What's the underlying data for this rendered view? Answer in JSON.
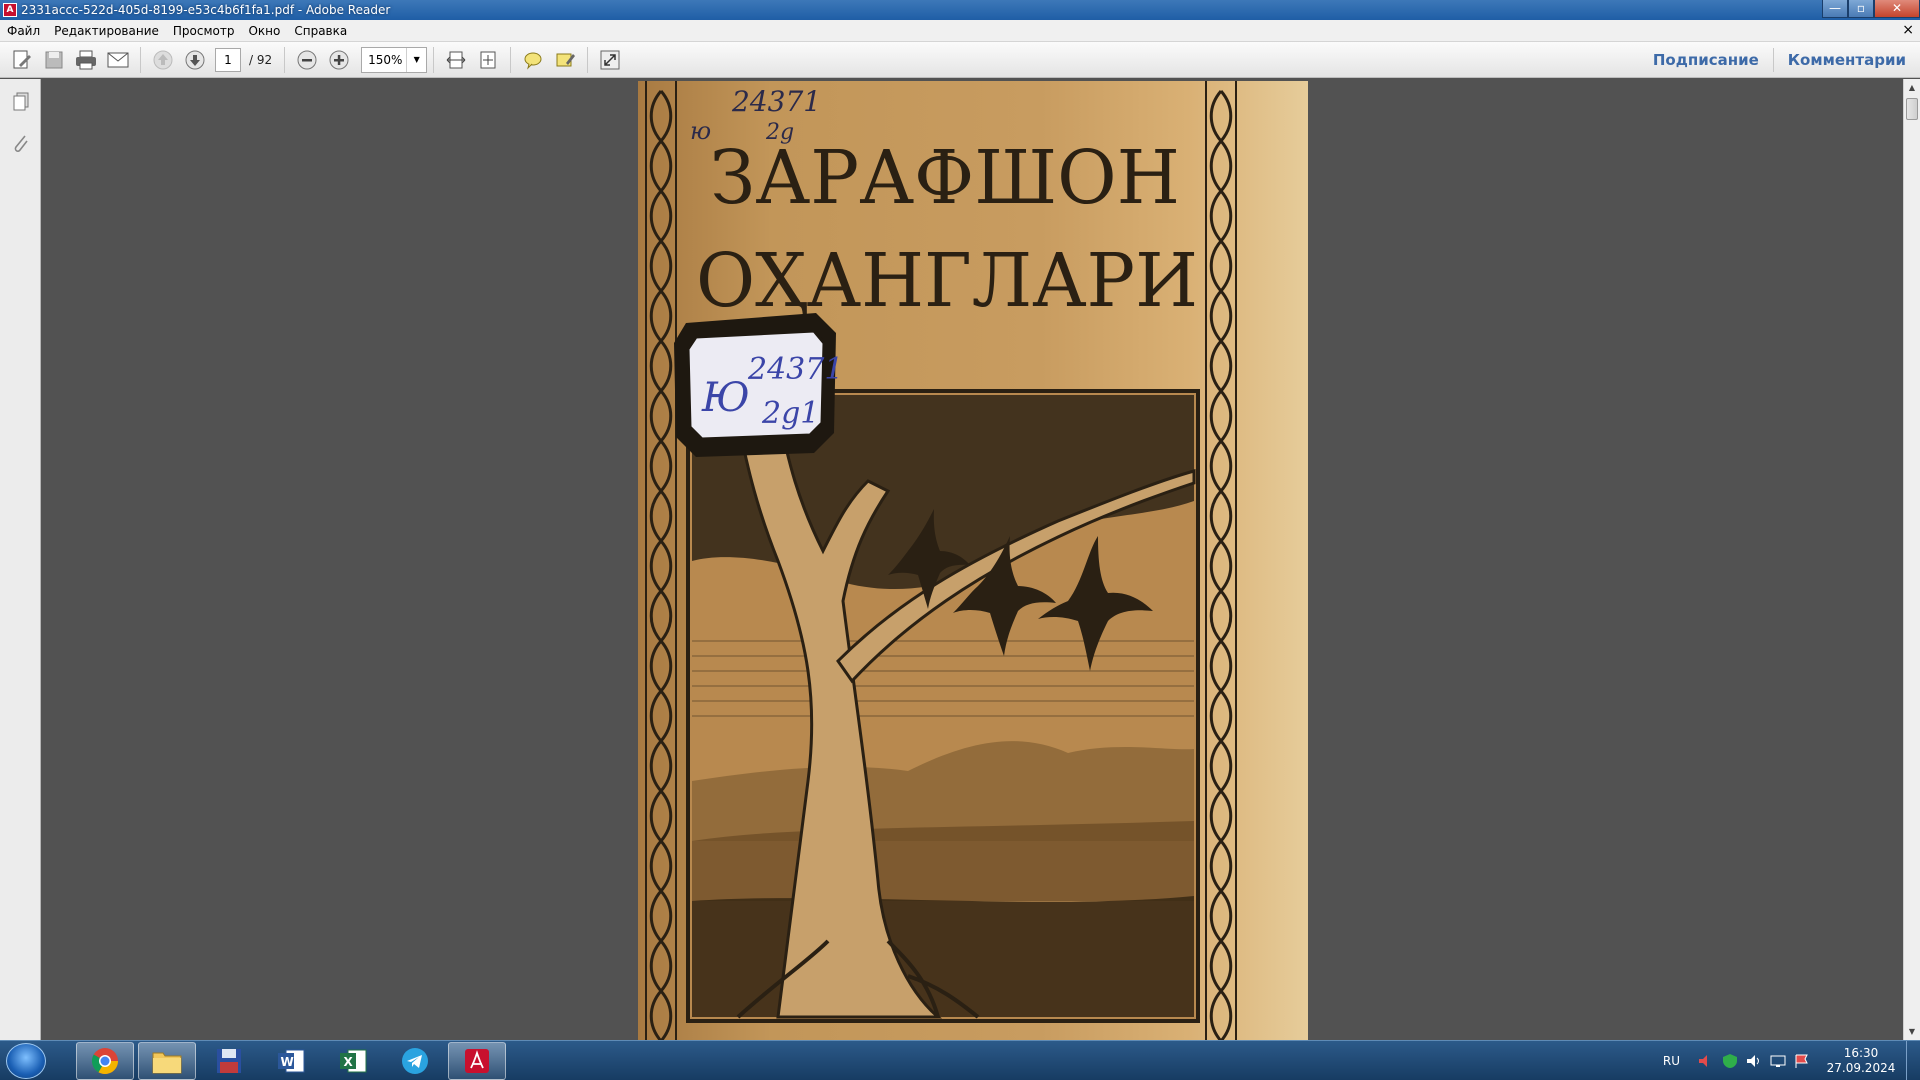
{
  "window": {
    "title": "2331accc-522d-405d-8199-e53c4b6f1fa1.pdf - Adobe Reader",
    "app_icon": "adobe-reader-icon",
    "minimize": "—",
    "maximize": "▫",
    "close": "✕"
  },
  "menu": {
    "items": [
      "Файл",
      "Редактирование",
      "Просмотр",
      "Окно",
      "Справка"
    ],
    "doc_close": "×"
  },
  "toolbar": {
    "page_current": "1",
    "page_total": "/ 92",
    "zoom": "150%",
    "sign_label": "Подписание",
    "comments_label": "Комментарии"
  },
  "document": {
    "cover_title_line1": "ЗАРАФШОН",
    "cover_title_line2": "ОҲАНГЛАРИ",
    "handwritten_top_number": "24371",
    "handwritten_top_prefix": "ю",
    "handwritten_top_suffix": "2g",
    "stamp_line1": "24371",
    "stamp_prefix": "Ю",
    "stamp_line2": "2g1"
  },
  "taskbar": {
    "apps": [
      "chrome-icon",
      "file-explorer-icon",
      "save-disk-icon",
      "word-icon",
      "excel-icon",
      "telegram-icon",
      "adobe-reader-icon"
    ],
    "language": "RU",
    "time": "16:30",
    "date": "27.09.2024"
  },
  "colors": {
    "titlebar": "#1f5ea6",
    "link_blue": "#3d6aa8",
    "doc_bg": "#525252",
    "cover_tan": "#c29659",
    "ink": "#2a2013"
  }
}
